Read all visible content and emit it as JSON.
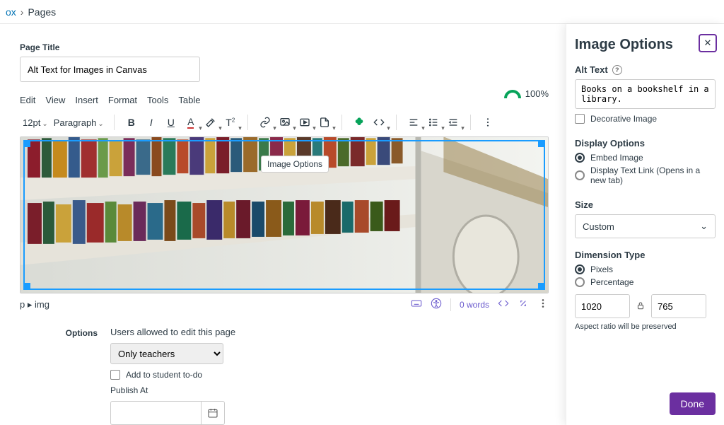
{
  "breadcrumb": {
    "prev": "ox",
    "current": "Pages"
  },
  "page_title": {
    "label": "Page Title",
    "value": "Alt Text for Images in Canvas"
  },
  "menus": {
    "edit": "Edit",
    "view": "View",
    "insert": "Insert",
    "format": "Format",
    "tools": "Tools",
    "table": "Table"
  },
  "a11y_score": "100%",
  "toolbar": {
    "font_size": "12pt",
    "block_format": "Paragraph"
  },
  "tooltip": {
    "image_options": "Image Options"
  },
  "statusbar": {
    "path_p": "p",
    "path_img": "img",
    "word_count": "0 words"
  },
  "options": {
    "label": "Options",
    "note": "Users allowed to edit this page",
    "who_can_edit": "Only teachers",
    "add_todo": "Add to student to-do",
    "publish_at_label": "Publish At",
    "publish_at_value": ""
  },
  "panel": {
    "title": "Image Options",
    "alt_label": "Alt Text",
    "alt_value": "Books on a bookshelf in a library.",
    "decorative": "Decorative Image",
    "display_label": "Display Options",
    "display_embed": "Embed Image",
    "display_link": "Display Text Link (Opens in a new tab)",
    "size_label": "Size",
    "size_value": "Custom",
    "dim_label": "Dimension Type",
    "dim_pixels": "Pixels",
    "dim_percent": "Percentage",
    "width": "1020",
    "height": "765",
    "aspect_note": "Aspect ratio will be preserved",
    "done": "Done"
  }
}
